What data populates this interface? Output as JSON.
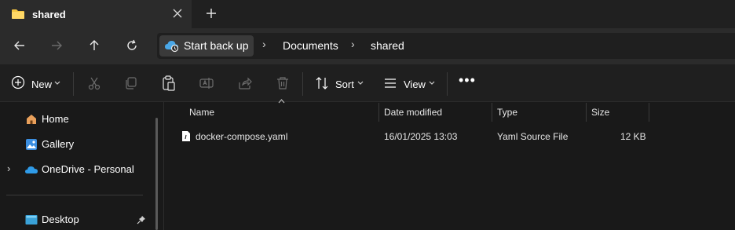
{
  "tab": {
    "title": "shared",
    "close_icon": "close-icon",
    "new_tab_icon": "plus-icon"
  },
  "nav": {
    "back_icon": "arrow-left-icon",
    "forward_icon": "arrow-right-icon",
    "up_icon": "arrow-up-icon",
    "refresh_icon": "refresh-icon"
  },
  "address": {
    "crumbs": [
      "Start back up",
      "Documents",
      "shared"
    ],
    "separator": "›"
  },
  "toolbar": {
    "new_label": "New",
    "sort_label": "Sort",
    "view_label": "View",
    "more_label": "•••",
    "icons": [
      "plus-circle-icon",
      "cut-icon",
      "copy-icon",
      "paste-icon",
      "rename-icon",
      "share-icon",
      "delete-icon",
      "sort-icon",
      "view-icon",
      "more-icon"
    ]
  },
  "sidebar": {
    "items": [
      {
        "label": "Home",
        "icon": "home-icon"
      },
      {
        "label": "Gallery",
        "icon": "gallery-icon"
      },
      {
        "label": "OneDrive - Personal",
        "icon": "onedrive-cloud-icon"
      },
      {
        "label": "Desktop",
        "icon": "desktop-icon"
      }
    ],
    "expand_glyph": "›",
    "pin_icon": "pin-icon"
  },
  "filelist": {
    "columns": [
      "Name",
      "Date modified",
      "Type",
      "Size"
    ],
    "rows": [
      {
        "name": "docker-compose.yaml",
        "date": "16/01/2025 13:03",
        "type": "Yaml Source File",
        "size": "12 KB"
      }
    ]
  },
  "colors": {
    "accent": "#4aa8e8",
    "folder": "#f5c542",
    "background": "#191919",
    "chrome": "#2b2b2b"
  }
}
